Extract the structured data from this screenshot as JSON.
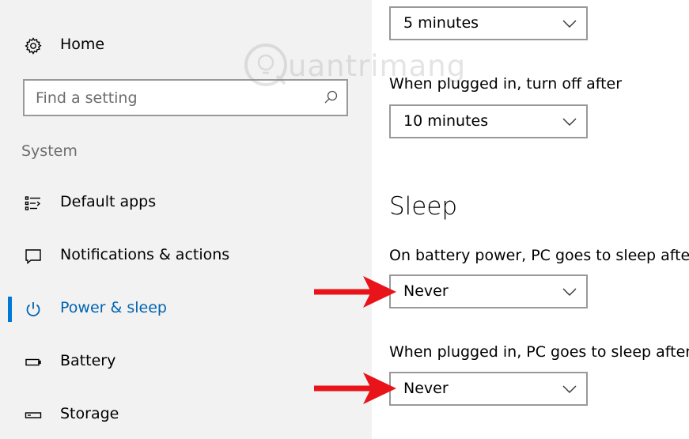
{
  "sidebar": {
    "home_label": "Home",
    "search_placeholder": "Find a setting",
    "section_label": "System",
    "items": [
      {
        "label": "Default apps",
        "icon": "default-apps-icon"
      },
      {
        "label": "Notifications & actions",
        "icon": "notifications-icon"
      },
      {
        "label": "Power & sleep",
        "icon": "power-icon",
        "active": true
      },
      {
        "label": "Battery",
        "icon": "battery-icon"
      },
      {
        "label": "Storage",
        "icon": "storage-icon"
      }
    ]
  },
  "content": {
    "screen_battery_value": "5 minutes",
    "screen_plugged_label": "When plugged in, turn off after",
    "screen_plugged_value": "10 minutes",
    "sleep_heading": "Sleep",
    "sleep_battery_label": "On battery power, PC goes to sleep after",
    "sleep_battery_value": "Never",
    "sleep_plugged_label": "When plugged in, PC goes to sleep after",
    "sleep_plugged_value": "Never"
  },
  "watermark": {
    "text": "uantrimang"
  },
  "colors": {
    "accent": "#0078d7",
    "active_text": "#0063b1",
    "sidebar_bg": "#f2f2f2",
    "arrow": "#e8141a"
  }
}
